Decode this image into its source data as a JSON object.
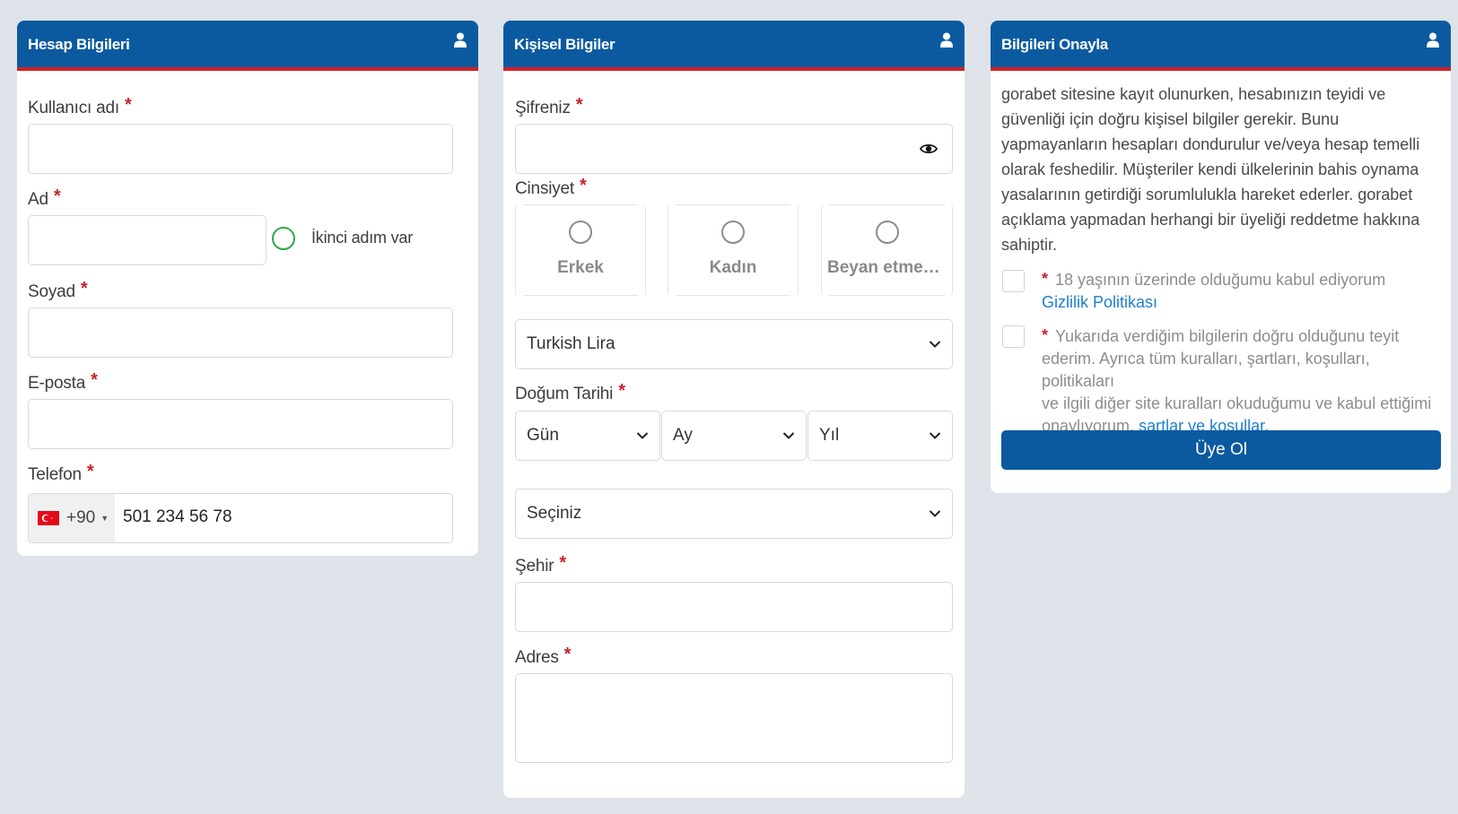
{
  "account_card": {
    "title": "Hesap Bilgileri",
    "icon": "user-icon",
    "username_label": "Kullanıcı adı",
    "first_name_label": "Ad",
    "second_name_toggle_label": "İkinci adım var",
    "surname_label": "Soyad",
    "email_label": "E-posta",
    "phone_label": "Telefon",
    "phone_country_code": "+90",
    "phone_value": "501 234 56 78",
    "required_mark": "*"
  },
  "personal_card": {
    "title": "Kişisel Bilgiler",
    "icon": "user-icon",
    "password_label": "Şifreniz",
    "gender_label": "Cinsiyet",
    "gender_options": [
      "Erkek",
      "Kadın",
      "Beyan etmek i..."
    ],
    "currency_value": "Turkish Lira",
    "birth_date_label": "Doğum Tarihi",
    "birth_day_value": "Gün",
    "birth_month_value": "Ay",
    "birth_year_value": "Yıl",
    "extra_select_value": "Seçiniz",
    "city_label": "Şehir",
    "address_label": "Adres",
    "required_mark": "*"
  },
  "confirm_card": {
    "title": "Bilgileri Onayla",
    "icon": "user-icon",
    "terms_paragraph_lines": [
      "gorabet sitesine kayıt olunurken, hesabınızın teyidi ve",
      "güvenliği için doğru kişisel bilgiler gerekir. Bunu",
      "yapmayanların hesapları dondurulur ve/veya hesap temelli",
      "olarak feshedilir. Müşteriler kendi ülkelerinin bahis oynama",
      "yasalarının getirdiği sorumlulukla hareket ederler. gorabet",
      "açıklama yapmadan herhangi bir üyeliği reddetme hakkına",
      "sahiptir."
    ],
    "age_check_text": "18 yaşının üzerinde olduğumu kabul ediyorum",
    "privacy_link": "Gizlilik Politikası",
    "info_check_lines": [
      "Yukarıda verdiğim bilgilerin doğru olduğunu teyit",
      "ederim. Ayrıca tüm kuralları, şartları, koşulları, politikaları",
      "ve ilgili diğer site kuralları okuduğumu ve kabul ettiğimi"
    ],
    "info_check_last_line_prefix": "onaylıyorum.",
    "terms_link": "şartlar ve koşullar",
    "terms_link_suffix": ".",
    "submit_label": "Üye Ol",
    "required_mark": "*"
  },
  "colors": {
    "header_bg": "#0b5aa0",
    "header_border": "#d41f26",
    "page_bg": "#dde3e9",
    "link": "#1f7fd0",
    "required": "#c8232c",
    "toggle_ring": "#2faa4a"
  }
}
